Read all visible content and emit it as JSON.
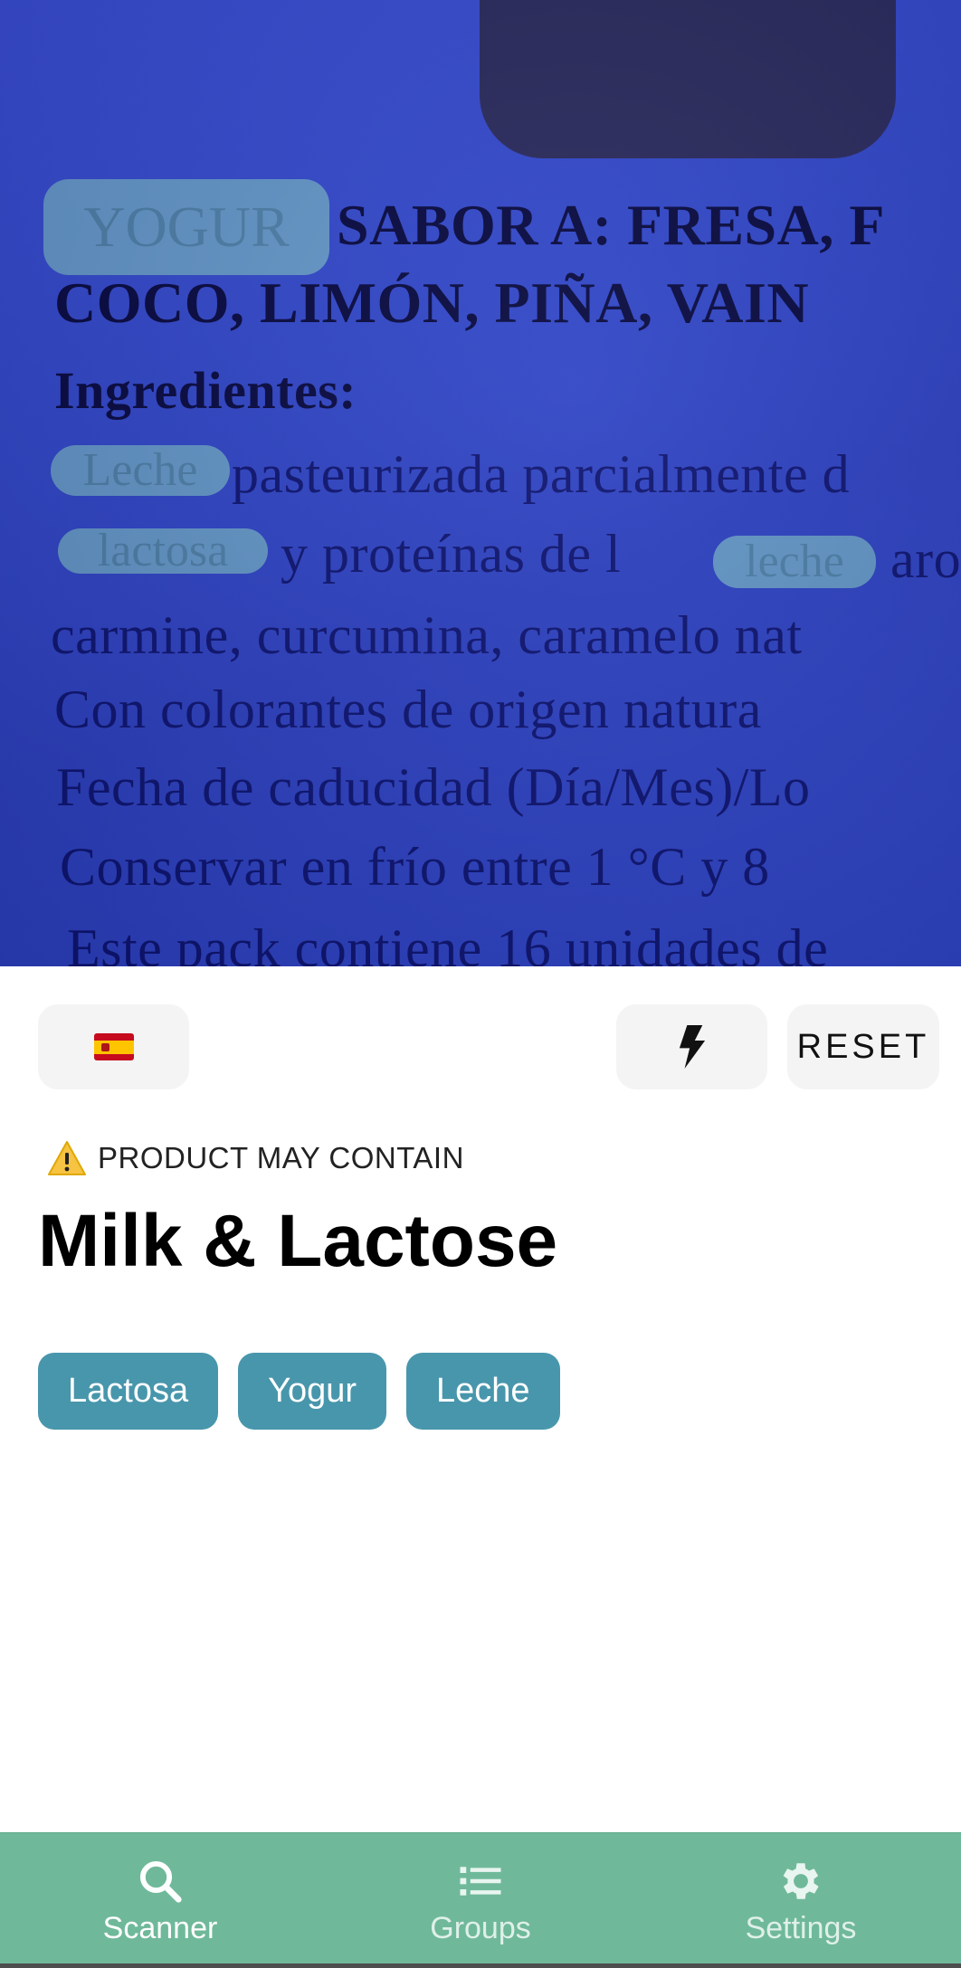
{
  "camera": {
    "lines": [
      "SABOR A: FRESA, F",
      "COCO, LIMÓN, PIÑA, VAIN",
      "Ingredientes:",
      "pasteurizada parcialmente d",
      "y proteínas de l",
      "carmine, curcumina, caramelo nat",
      "Con colorantes de origen natura",
      "Fecha de caducidad (Día/Mes)/Lo",
      "Conservar en frío entre 1 °C y 8",
      "Este pack contiene 16 unidades de"
    ],
    "highlights": [
      "YOGUR",
      "Leche",
      "lactosa",
      "leche"
    ],
    "extra_fragment": "aro"
  },
  "toolbar": {
    "language_icon": "spain-flag-icon",
    "flash_icon": "flash-icon",
    "reset_label": "RESET"
  },
  "result": {
    "warning_label": "PRODUCT MAY CONTAIN",
    "title": "Milk & Lactose",
    "chips": [
      "Lactosa",
      "Yogur",
      "Leche"
    ]
  },
  "nav": {
    "items": [
      {
        "label": "Scanner",
        "icon": "search-icon",
        "active": true
      },
      {
        "label": "Groups",
        "icon": "list-icon",
        "active": false
      },
      {
        "label": "Settings",
        "icon": "gear-icon",
        "active": false
      }
    ]
  },
  "colors": {
    "nav_background": "#6fb99a",
    "chip_background": "#4896ac",
    "camera_tint": "#3147c9"
  }
}
